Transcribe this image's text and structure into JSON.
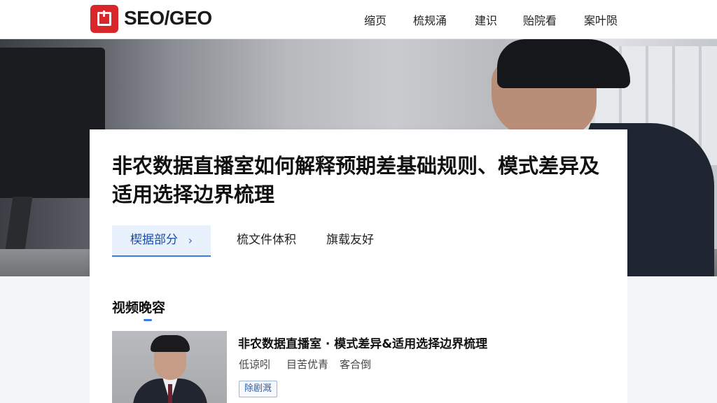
{
  "header": {
    "brand": "SEO/GEO",
    "nav": [
      "缩页",
      "梳规涌",
      "建识",
      "贻院看",
      "案叶陨"
    ]
  },
  "hero": {
    "title": "非农数据直播室如何解释预期差基础规则、模式差异及适用选择边界梳理"
  },
  "tabs": {
    "active_label": "楔据部分",
    "items": [
      "梳文件体积",
      "旗载友好"
    ]
  },
  "section": {
    "title": "视频晚容",
    "item": {
      "title": "非农数据直播室 · 模式差异&适用选择边界梳理",
      "meta": [
        "低谅吲",
        "目苦优青",
        "客合倒"
      ],
      "badge": "除剧溉"
    }
  },
  "colors": {
    "brand_red": "#d8262a",
    "accent_blue": "#3b7de0"
  },
  "icons": [
    "logo-icon",
    "chevron-right-icon"
  ]
}
